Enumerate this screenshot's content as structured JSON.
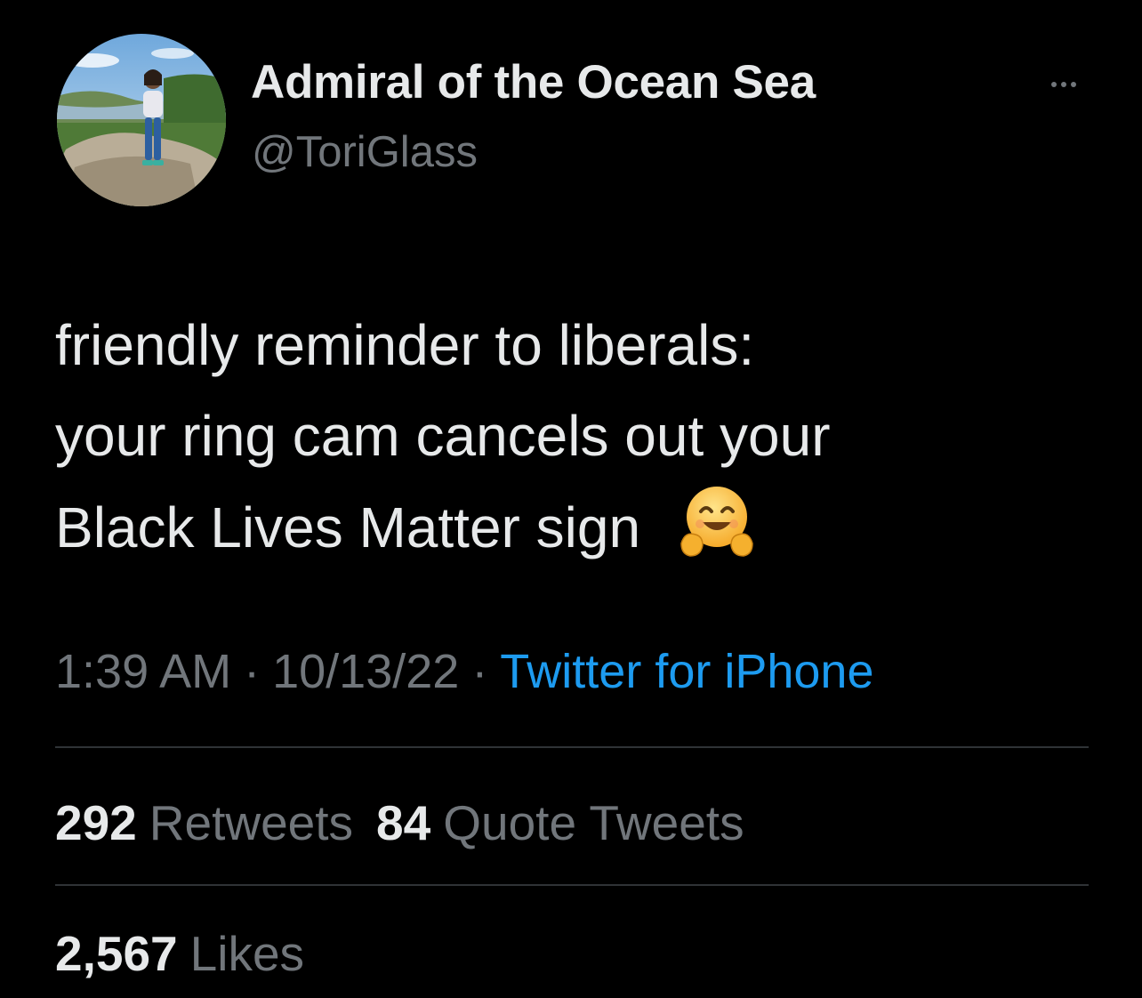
{
  "user": {
    "display_name": "Admiral of the Ocean Sea",
    "handle": "@ToriGlass",
    "avatar_icon": "profile-photo"
  },
  "more_icon": "more-dots-icon",
  "tweet": {
    "lines": [
      "friendly reminder to liberals:",
      "your ring cam cancels out your",
      "Black Lives Matter sign"
    ],
    "emoji": "hugging-face-emoji"
  },
  "meta": {
    "time": "1:39 AM",
    "separator": "·",
    "date": "10/13/22",
    "source": "Twitter for iPhone"
  },
  "stats": {
    "retweets": {
      "count": "292",
      "label": "Retweets"
    },
    "quotes": {
      "count": "84",
      "label": "Quote Tweets"
    },
    "likes": {
      "count": "2,567",
      "label": "Likes"
    }
  },
  "colors": {
    "background": "#000000",
    "primary_text": "#e7e9ea",
    "secondary_text": "#71767b",
    "link": "#1d9bf0",
    "divider": "#2f3336"
  }
}
